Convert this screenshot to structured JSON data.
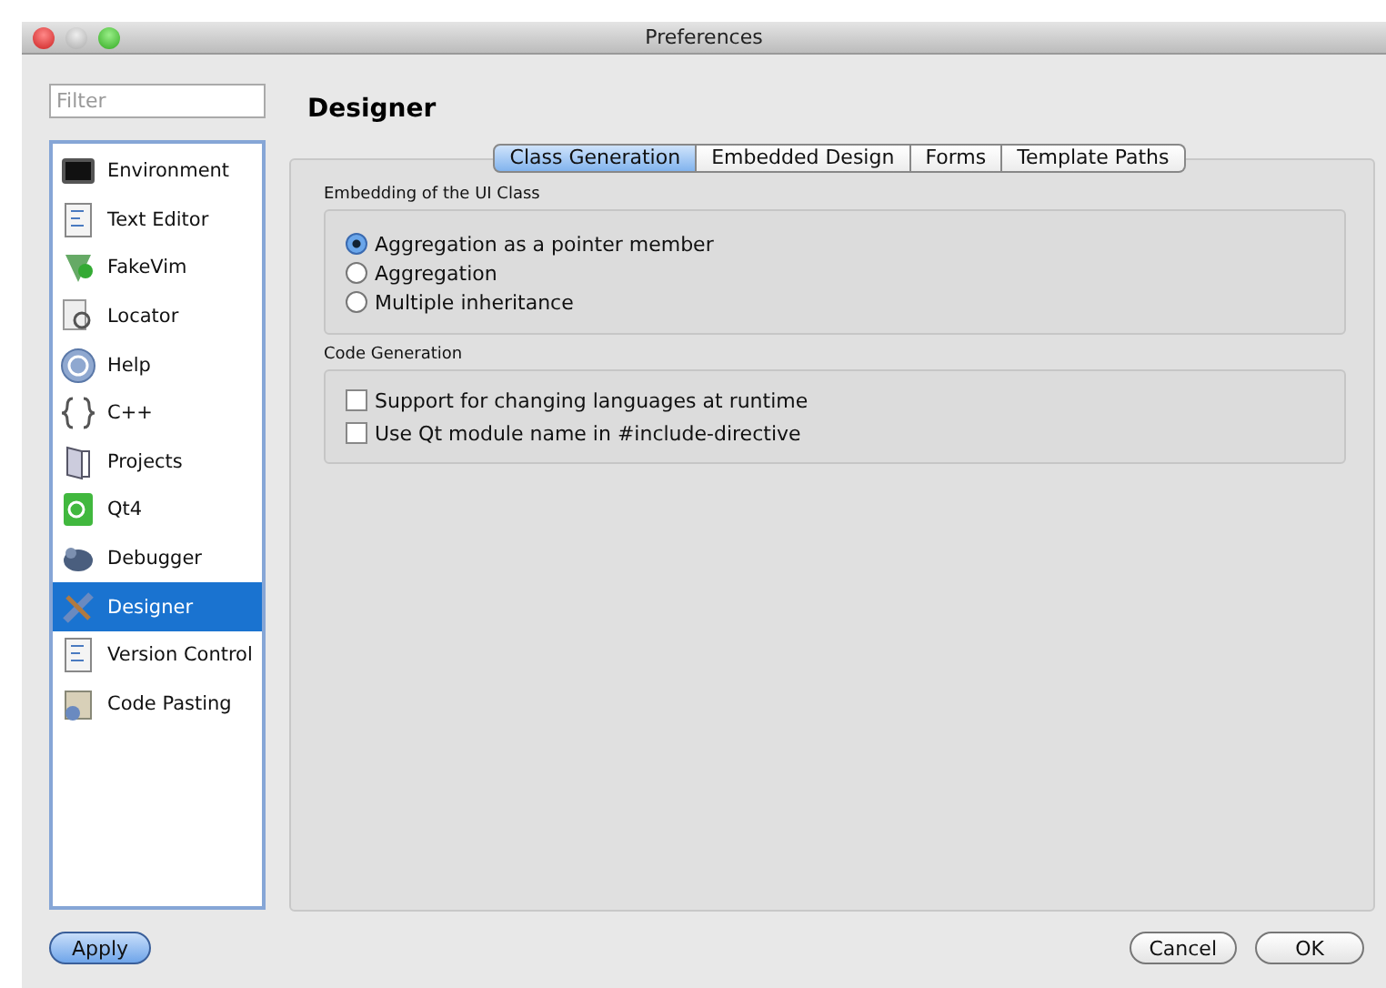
{
  "window": {
    "title": "Preferences"
  },
  "filter": {
    "placeholder": "Filter"
  },
  "sidebar": {
    "items": [
      {
        "label": "Environment",
        "selected": false
      },
      {
        "label": "Text Editor",
        "selected": false
      },
      {
        "label": "FakeVim",
        "selected": false
      },
      {
        "label": "Locator",
        "selected": false
      },
      {
        "label": "Help",
        "selected": false
      },
      {
        "label": "C++",
        "selected": false
      },
      {
        "label": "Projects",
        "selected": false
      },
      {
        "label": "Qt4",
        "selected": false
      },
      {
        "label": "Debugger",
        "selected": false
      },
      {
        "label": "Designer",
        "selected": true
      },
      {
        "label": "Version Control",
        "selected": false
      },
      {
        "label": "Code Pasting",
        "selected": false
      }
    ]
  },
  "page_title": "Designer",
  "tabs": [
    {
      "label": "Class Generation",
      "selected": true
    },
    {
      "label": "Embedded Design",
      "selected": false
    },
    {
      "label": "Forms",
      "selected": false
    },
    {
      "label": "Template Paths",
      "selected": false
    }
  ],
  "groups": [
    {
      "title": "Embedding of the UI Class",
      "options": [
        {
          "kind": "radio",
          "label": "Aggregation as a pointer member",
          "checked": true
        },
        {
          "kind": "radio",
          "label": "Aggregation",
          "checked": false
        },
        {
          "kind": "radio",
          "label": "Multiple inheritance",
          "checked": false
        }
      ]
    },
    {
      "title": "Code Generation",
      "options": [
        {
          "kind": "checkbox",
          "label": "Support for changing languages at runtime",
          "checked": false
        },
        {
          "kind": "checkbox",
          "label": "Use Qt module name in #include-directive",
          "checked": false
        }
      ]
    }
  ],
  "buttons": {
    "apply": "Apply",
    "cancel": "Cancel",
    "ok": "OK"
  }
}
